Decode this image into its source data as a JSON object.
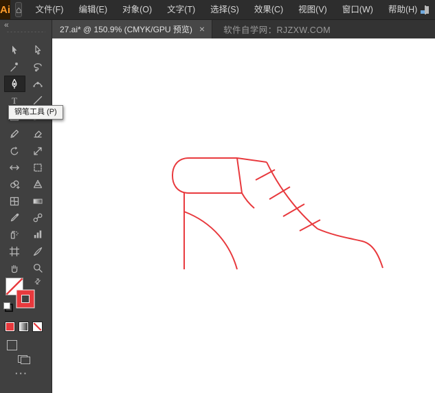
{
  "app": {
    "logo_text": "Ai",
    "menu_items": [
      "文件(F)",
      "编辑(E)",
      "对象(O)",
      "文字(T)",
      "选择(S)",
      "效果(C)",
      "视图(V)",
      "窗口(W)",
      "帮助(H)"
    ]
  },
  "icons": {
    "home": "⌂",
    "collapse": "«",
    "close_tab": "×",
    "swap_fill_stroke": "⇄",
    "toolbar_ellipsis": "···"
  },
  "tab_bar": {
    "document_tab": "27.ai* @ 150.9% (CMYK/GPU 预览)",
    "watermark": "软件自学网：RJZXW.COM"
  },
  "tools": {
    "selected": "pen-tool",
    "list": [
      "selection-tool",
      "direct-selection-tool",
      "magic-wand-tool",
      "lasso-tool",
      "pen-tool",
      "curvature-tool",
      "type-tool",
      "line-segment-tool",
      "rectangle-tool",
      "paintbrush-tool",
      "pencil-tool",
      "eraser-tool",
      "rotate-tool",
      "scale-tool",
      "width-tool",
      "free-transform-tool",
      "shape-builder-tool",
      "perspective-grid-tool",
      "mesh-tool",
      "gradient-tool",
      "eyedropper-tool",
      "blend-tool",
      "symbol-sprayer-tool",
      "column-graph-tool",
      "artboard-tool",
      "slice-tool",
      "hand-tool",
      "zoom-tool"
    ]
  },
  "tooltip": {
    "text": "钢笔工具 (P)"
  },
  "canvas": {
    "background": "#ffffff",
    "stroke_color": "#e8393d"
  }
}
